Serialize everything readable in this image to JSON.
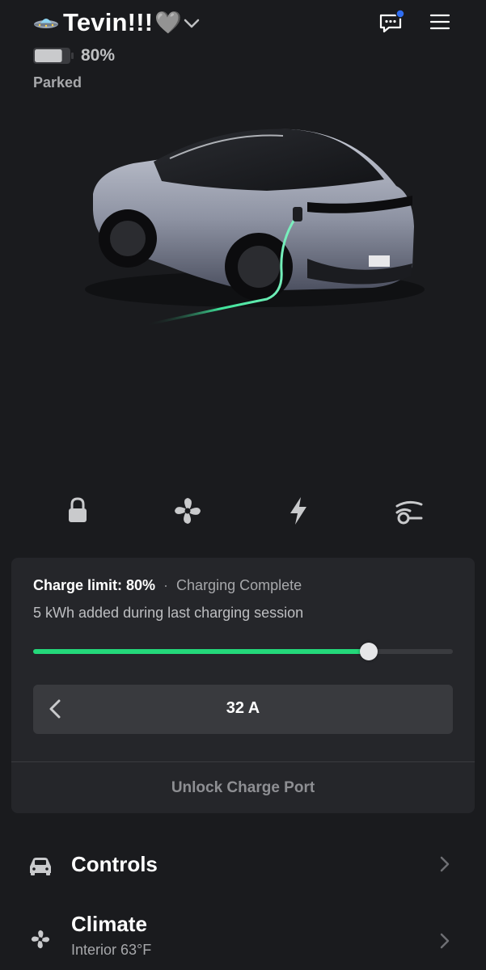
{
  "header": {
    "vehicle_name": "Tevin!!!",
    "name_icon": "flying-saucer-icon",
    "name_emoji_suffix": "🩶",
    "chat_has_notification": true,
    "notification_color": "#2f6df0"
  },
  "battery": {
    "percent_label": "80%",
    "level": 0.8
  },
  "status": "Parked",
  "quick_actions": [
    {
      "name": "lock",
      "icon": "lock-icon"
    },
    {
      "name": "climate",
      "icon": "fan-icon"
    },
    {
      "name": "charging",
      "icon": "lightning-icon"
    },
    {
      "name": "charge-port",
      "icon": "charge-port-icon"
    }
  ],
  "charge": {
    "limit_label": "Charge limit: 80%",
    "separator": "·",
    "state": "Charging Complete",
    "session_text": "5 kWh added during last charging session",
    "limit_fraction": 0.8,
    "accent_color": "#24d87a",
    "amps_label": "32 A",
    "unlock_label": "Unlock Charge Port"
  },
  "menu": [
    {
      "title": "Controls",
      "subtitle": "",
      "icon": "car-icon"
    },
    {
      "title": "Climate",
      "subtitle": "Interior 63°F",
      "icon": "fan-icon"
    }
  ]
}
